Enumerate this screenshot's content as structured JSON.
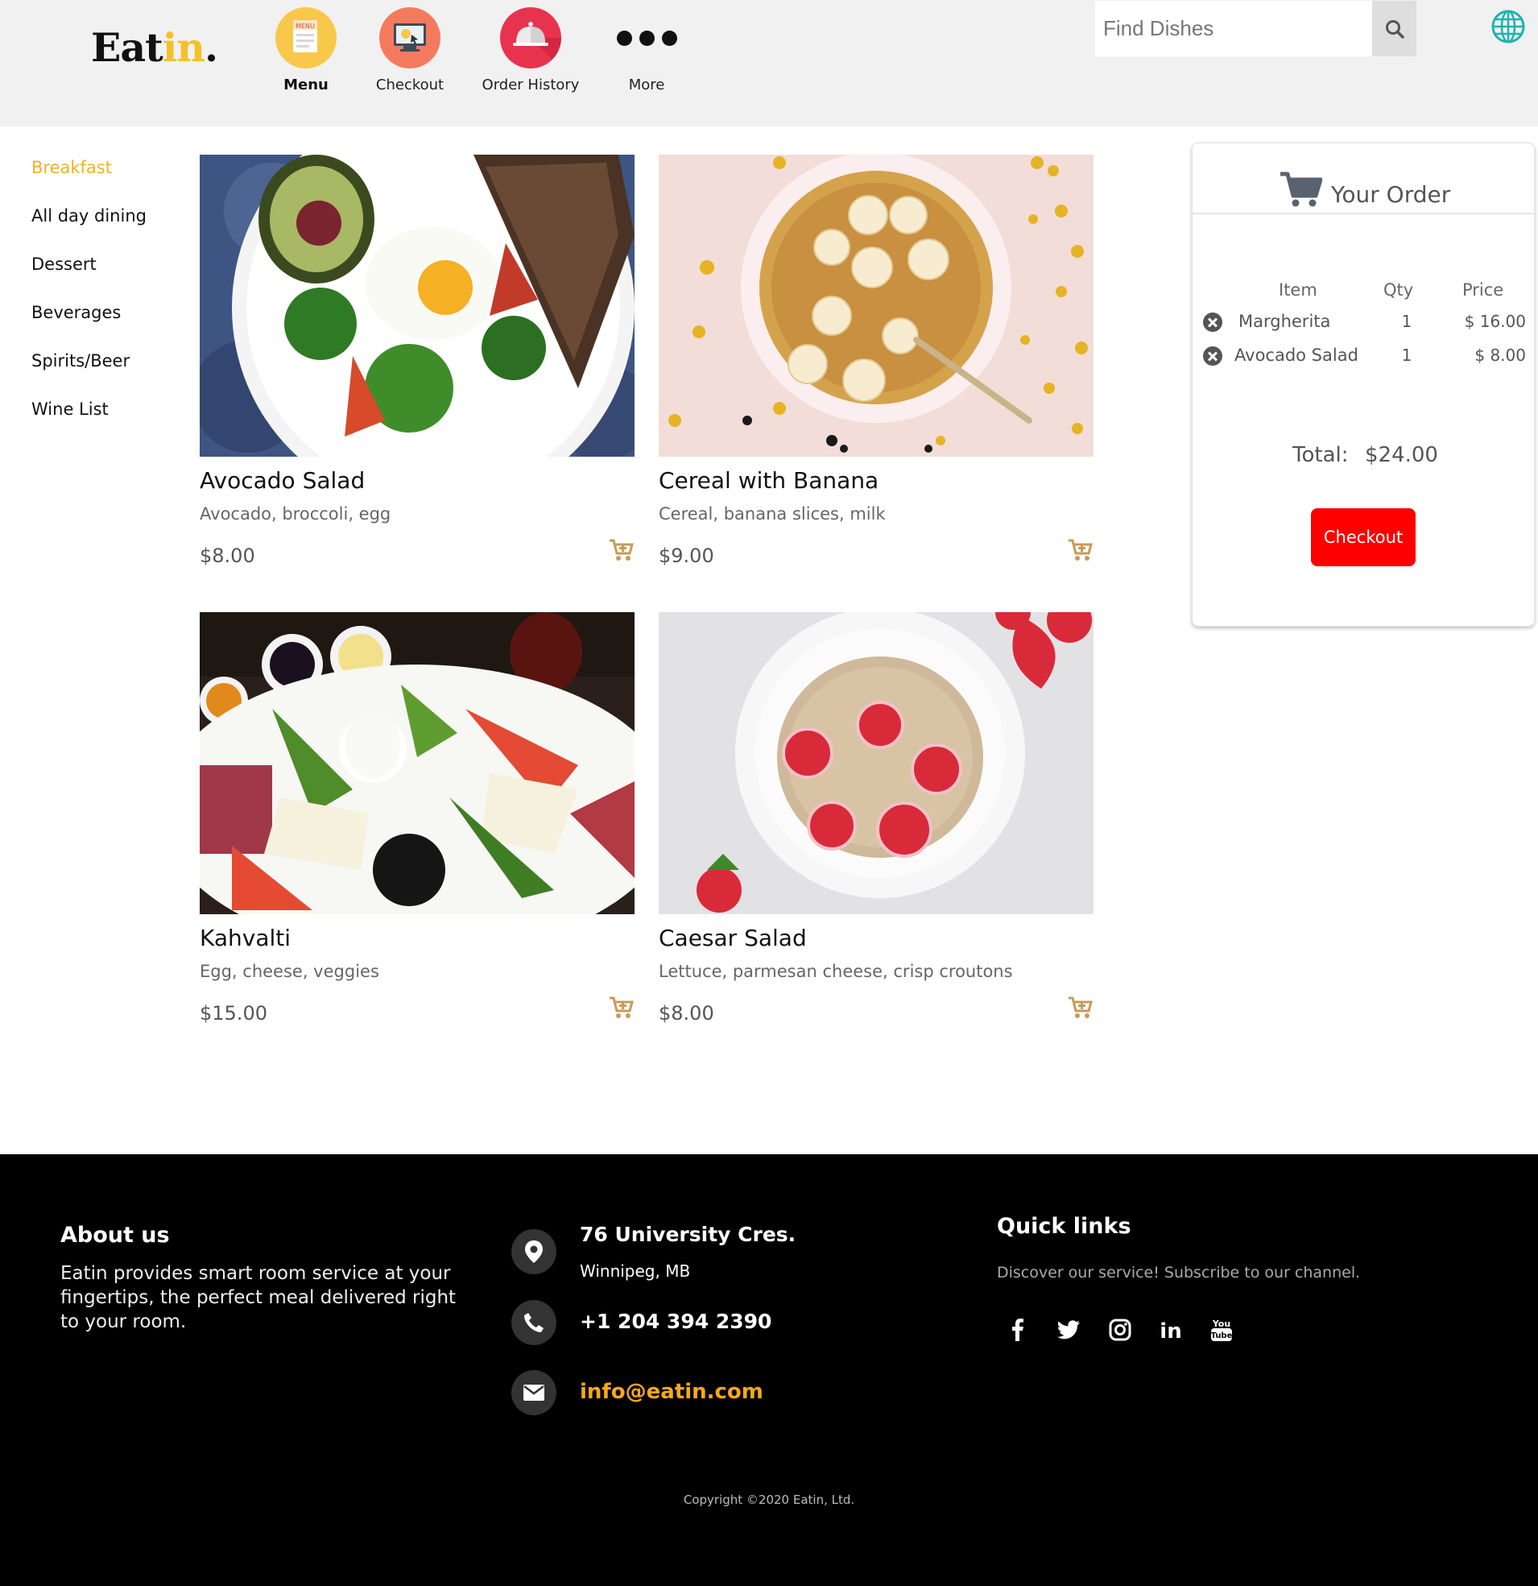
{
  "brand": {
    "logo_main": "Eat",
    "logo_highlight": "in",
    "logo_dot": ".",
    "accent_color": "#f5c12b"
  },
  "nav": {
    "menu": "Menu",
    "checkout": "Checkout",
    "order_history": "Order History",
    "more": "More",
    "menu_icon_text": "MENU"
  },
  "search": {
    "placeholder": "Find Dishes"
  },
  "sidebar": {
    "items": [
      {
        "label": "Breakfast"
      },
      {
        "label": "All day dining"
      },
      {
        "label": "Dessert"
      },
      {
        "label": "Beverages"
      },
      {
        "label": "Spirits/Beer"
      },
      {
        "label": "Wine List"
      }
    ],
    "active_color": "#f5b025"
  },
  "dishes": [
    {
      "name": "Avocado Salad",
      "desc": "Avocado, broccoli, egg",
      "price": "$8.00"
    },
    {
      "name": "Cereal with Banana",
      "desc": "Cereal, banana slices, milk",
      "price": "$9.00"
    },
    {
      "name": "Kahvalti",
      "desc": "Egg, cheese, veggies",
      "price": "$15.00"
    },
    {
      "name": "Caesar Salad",
      "desc": "Lettuce, parmesan cheese, crisp croutons",
      "price": "$8.00"
    }
  ],
  "order": {
    "title": "Your Order",
    "col_item": "Item",
    "col_qty": "Qty",
    "col_price": "Price",
    "rows": [
      {
        "name": "Margherita",
        "qty": "1",
        "price": "$ 16.00"
      },
      {
        "name": "Avocado Salad",
        "qty": "1",
        "price": "$ 8.00"
      }
    ],
    "total_label": "Total:",
    "total_value": "$24.00",
    "checkout_label": "Checkout",
    "checkout_color": "#fe0000"
  },
  "footer": {
    "about_heading": "About us",
    "about_text": "Eatin provides smart room service at your fingertips, the perfect meal delivered right to your room.",
    "address_line1": "76 University Cres.",
    "address_line2": "Winnipeg, MB",
    "phone": "+1 204 394 2390",
    "email": "info@eatin.com",
    "quick_links_heading": "Quick links",
    "quick_links_text": "Discover our service! Subscribe to our channel.",
    "social": [
      "facebook-icon",
      "twitter-icon",
      "instagram-icon",
      "linkedin-icon",
      "youtube-icon"
    ],
    "youtube_you": "You",
    "youtube_tube": "Tube",
    "linkedin_text": "in",
    "copyright": "Copyright ©2020 Eatin, Ltd."
  }
}
